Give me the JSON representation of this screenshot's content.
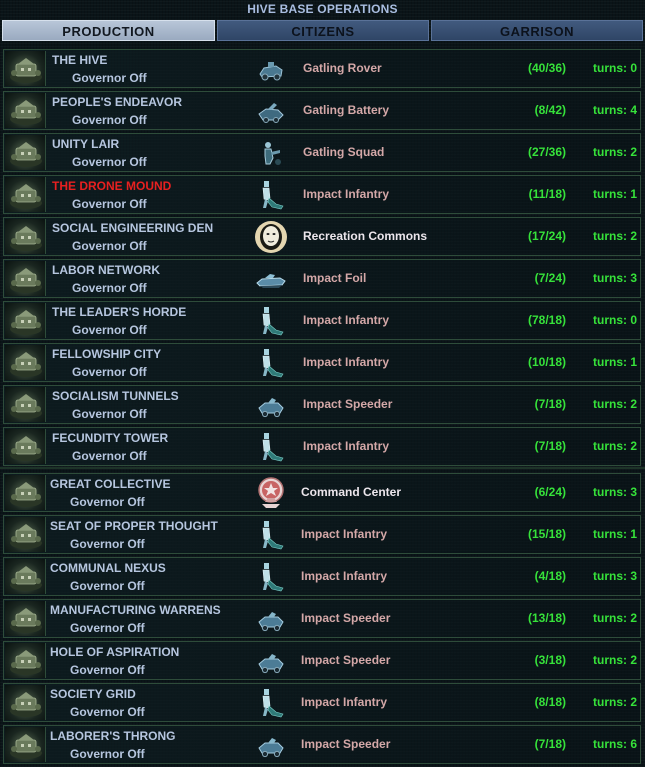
{
  "window": {
    "title": "HIVE BASE OPERATIONS"
  },
  "tabs": [
    {
      "label": "PRODUCTION",
      "active": true
    },
    {
      "label": "CITIZENS",
      "active": false
    },
    {
      "label": "GARRISON",
      "active": false
    }
  ],
  "colors": {
    "progress_text": "#36e23a",
    "alert_name": "#e82020",
    "unit_text": "#d4a8a8",
    "facility_text": "#ece6ec",
    "label_text": "#b6c6df"
  },
  "bases": [
    {
      "name": "THE HIVE",
      "governor": "Governor Off",
      "icon": "gatling-rover-icon",
      "item": "Gatling Rover",
      "item_kind": "unit",
      "progress": "(40/36)",
      "turns": "turns: 0",
      "alert": false
    },
    {
      "name": "PEOPLE'S ENDEAVOR",
      "governor": "Governor Off",
      "icon": "gatling-battery-icon",
      "item": "Gatling Battery",
      "item_kind": "unit",
      "progress": "(8/42)",
      "turns": "turns: 4",
      "alert": false
    },
    {
      "name": "UNITY LAIR",
      "governor": "Governor Off",
      "icon": "gatling-squad-icon",
      "item": "Gatling Squad",
      "item_kind": "unit",
      "progress": "(27/36)",
      "turns": "turns: 2",
      "alert": false
    },
    {
      "name": "THE DRONE MOUND",
      "governor": "Governor Off",
      "icon": "impact-infantry-icon",
      "item": "Impact Infantry",
      "item_kind": "unit",
      "progress": "(11/18)",
      "turns": "turns: 1",
      "alert": true
    },
    {
      "name": "SOCIAL ENGINEERING DEN",
      "governor": "Governor Off",
      "icon": "recreation-commons-icon",
      "item": "Recreation Commons",
      "item_kind": "facility",
      "progress": "(17/24)",
      "turns": "turns: 2",
      "alert": false
    },
    {
      "name": "LABOR NETWORK",
      "governor": "Governor Off",
      "icon": "impact-foil-icon",
      "item": "Impact Foil",
      "item_kind": "unit",
      "progress": "(7/24)",
      "turns": "turns: 3",
      "alert": false
    },
    {
      "name": "THE LEADER'S HORDE",
      "governor": "Governor Off",
      "icon": "impact-infantry-icon",
      "item": "Impact Infantry",
      "item_kind": "unit",
      "progress": "(78/18)",
      "turns": "turns: 0",
      "alert": false
    },
    {
      "name": "FELLOWSHIP CITY",
      "governor": "Governor Off",
      "icon": "impact-infantry-icon",
      "item": "Impact Infantry",
      "item_kind": "unit",
      "progress": "(10/18)",
      "turns": "turns: 1",
      "alert": false
    },
    {
      "name": "SOCIALISM TUNNELS",
      "governor": "Governor Off",
      "icon": "impact-speeder-icon",
      "item": "Impact Speeder",
      "item_kind": "unit",
      "progress": "(7/18)",
      "turns": "turns: 2",
      "alert": false
    },
    {
      "name": "FECUNDITY TOWER",
      "governor": "Governor Off",
      "icon": "impact-infantry-icon",
      "item": "Impact Infantry",
      "item_kind": "unit",
      "progress": "(7/18)",
      "turns": "turns: 2",
      "alert": false
    },
    {
      "name": "GREAT COLLECTIVE",
      "governor": "Governor Off",
      "icon": "command-center-icon",
      "item": "Command Center",
      "item_kind": "facility",
      "progress": "(6/24)",
      "turns": "turns: 3",
      "alert": false
    },
    {
      "name": "SEAT OF PROPER THOUGHT",
      "governor": "Governor Off",
      "icon": "impact-infantry-icon",
      "item": "Impact Infantry",
      "item_kind": "unit",
      "progress": "(15/18)",
      "turns": "turns: 1",
      "alert": false
    },
    {
      "name": "COMMUNAL NEXUS",
      "governor": "Governor Off",
      "icon": "impact-infantry-icon",
      "item": "Impact Infantry",
      "item_kind": "unit",
      "progress": "(4/18)",
      "turns": "turns: 3",
      "alert": false
    },
    {
      "name": "MANUFACTURING WARRENS",
      "governor": "Governor Off",
      "icon": "impact-speeder-icon",
      "item": "Impact Speeder",
      "item_kind": "unit",
      "progress": "(13/18)",
      "turns": "turns: 2",
      "alert": false
    },
    {
      "name": "HOLE OF ASPIRATION",
      "governor": "Governor Off",
      "icon": "impact-speeder-icon",
      "item": "Impact Speeder",
      "item_kind": "unit",
      "progress": "(3/18)",
      "turns": "turns: 2",
      "alert": false
    },
    {
      "name": "SOCIETY GRID",
      "governor": "Governor Off",
      "icon": "impact-infantry-icon",
      "item": "Impact Infantry",
      "item_kind": "unit",
      "progress": "(8/18)",
      "turns": "turns: 2",
      "alert": false
    },
    {
      "name": "LABORER'S THRONG",
      "governor": "Governor Off",
      "icon": "impact-speeder-icon",
      "item": "Impact Speeder",
      "item_kind": "unit",
      "progress": "(7/18)",
      "turns": "turns: 6",
      "alert": false
    }
  ]
}
